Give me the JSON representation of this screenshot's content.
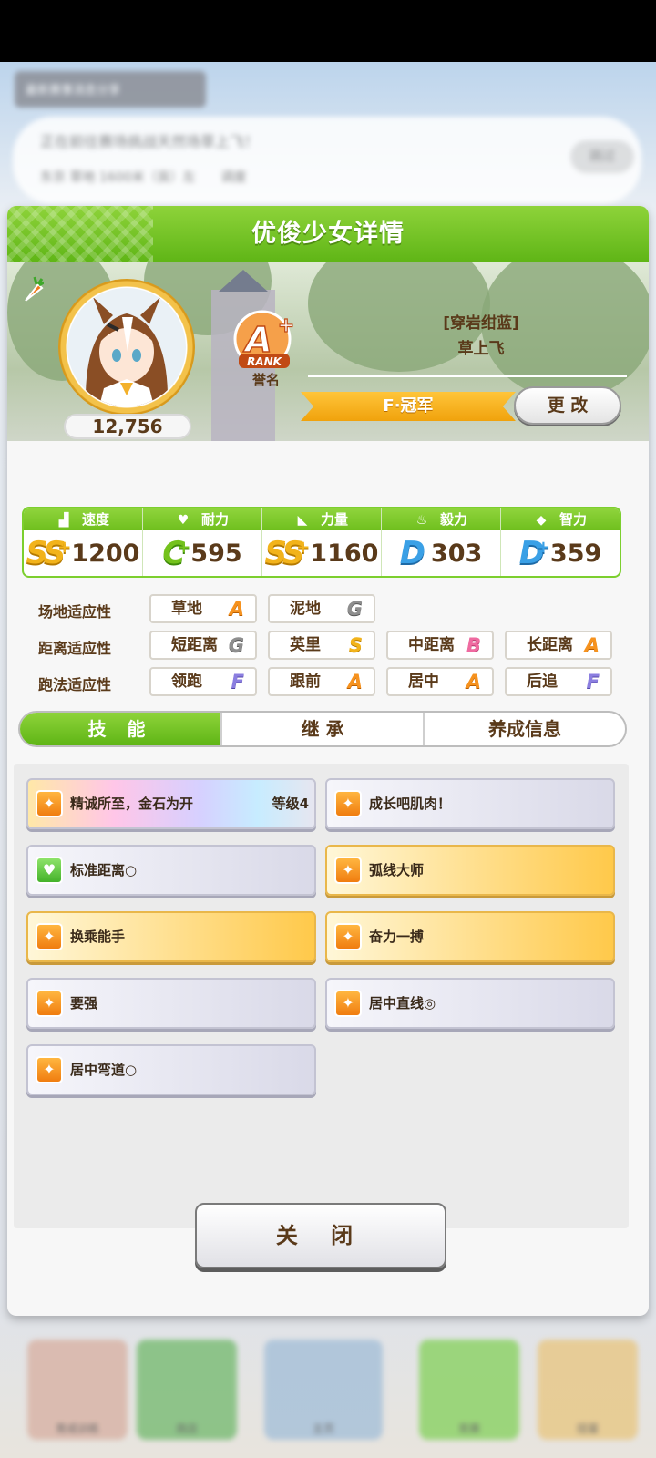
{
  "background": {
    "chip_text": "最新赛事消息分享",
    "bubble_line1": "正在前往赛场挑战天然场草上飞！",
    "bubble_line2": "东京 草地 1600米（良）左",
    "bubble_tag": "调度",
    "skip_label": "跳过",
    "nav": [
      "育成训练",
      "商店",
      "主页",
      "竞赛",
      "扭蛋"
    ]
  },
  "dialog": {
    "title": "优俊少女详情",
    "fans": "12,756",
    "rank_letter": "A",
    "rank_plus": "+",
    "rank_word": "RANK",
    "rank_label": "誉名",
    "epithet": "[穿岩绀蓝]",
    "name": "草上飞",
    "class_label": "F·冠军",
    "change_button": "更 改"
  },
  "stats": [
    {
      "label": "速度",
      "icon": "shoe-icon",
      "grade": "SS",
      "plus": "+",
      "value": "1200"
    },
    {
      "label": "耐力",
      "icon": "heart-icon",
      "grade": "C",
      "plus": "+",
      "value": "595"
    },
    {
      "label": "力量",
      "icon": "muscle-icon",
      "grade": "SS",
      "plus": "+",
      "value": "1160"
    },
    {
      "label": "毅力",
      "icon": "flame-icon",
      "grade": "D",
      "plus": "",
      "value": "303"
    },
    {
      "label": "智力",
      "icon": "graduation-cap-icon",
      "grade": "D",
      "plus": "+",
      "value": "359"
    }
  ],
  "aptitude": {
    "track": {
      "label": "场地适应性",
      "items": [
        {
          "name": "草地",
          "grade": "A"
        },
        {
          "name": "泥地",
          "grade": "G"
        }
      ]
    },
    "distance": {
      "label": "距离适应性",
      "items": [
        {
          "name": "短距离",
          "grade": "G"
        },
        {
          "name": "英里",
          "grade": "S"
        },
        {
          "name": "中距离",
          "grade": "B"
        },
        {
          "name": "长距离",
          "grade": "A"
        }
      ]
    },
    "style": {
      "label": "跑法适应性",
      "items": [
        {
          "name": "领跑",
          "grade": "F"
        },
        {
          "name": "跟前",
          "grade": "A"
        },
        {
          "name": "居中",
          "grade": "A"
        },
        {
          "name": "后追",
          "grade": "F"
        }
      ]
    }
  },
  "tabs": [
    "技 能",
    "继 承",
    "养成信息"
  ],
  "skills": [
    {
      "name": "精诚所至，金石为开",
      "level": "等级4",
      "style": "rainbow",
      "icon": "speed-up-icon"
    },
    {
      "name": "成长吧肌肉！",
      "level": "",
      "style": "normal",
      "icon": "speed-up-icon"
    },
    {
      "name": "标准距离○",
      "level": "",
      "style": "normal",
      "icon": "heal-icon"
    },
    {
      "name": "弧线大师",
      "level": "",
      "style": "gold",
      "icon": "speed-up-icon"
    },
    {
      "name": "换乘能手",
      "level": "",
      "style": "gold",
      "icon": "speed-up-icon"
    },
    {
      "name": "奋力一搏",
      "level": "",
      "style": "gold",
      "icon": "speed-up-icon"
    },
    {
      "name": "要强",
      "level": "",
      "style": "normal",
      "icon": "speed-up-icon"
    },
    {
      "name": "居中直线◎",
      "level": "",
      "style": "normal",
      "icon": "speed-up-icon"
    },
    {
      "name": "居中弯道○",
      "level": "",
      "style": "normal",
      "icon": "speed-up-icon"
    }
  ],
  "close_button": "关 闭"
}
